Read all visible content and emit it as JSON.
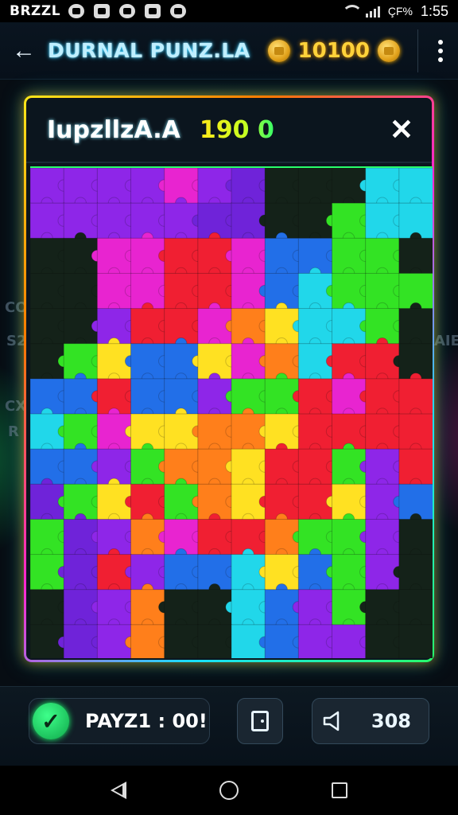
{
  "status_bar": {
    "carrier": "BRZZL",
    "battery": "ÇF%",
    "time": "1:55",
    "icons": [
      "whatsapp-icon",
      "image-icon",
      "alarm-icon",
      "screen-icon",
      "settings-icon"
    ]
  },
  "app_bar": {
    "title": "DURNAL PUNZ.LA",
    "coins": "10100"
  },
  "panel": {
    "title": "IupzllzA.A",
    "score": "190 0"
  },
  "background": {
    "left_text_1": "CO",
    "left_text_2": "S2",
    "left_text_3": "CX",
    "left_text_4": "R",
    "right_text_1": "AIE"
  },
  "toolbar": {
    "status_label": "PAYZ1 : 00!",
    "sound_value": "308"
  },
  "board": {
    "cols": 12,
    "rows": 14,
    "palette": {
      "purple": "#8a1ee8",
      "violet": "#6a1bd8",
      "magenta": "#e81ccf",
      "red": "#f0162a",
      "orange": "#ff7a12",
      "yellow": "#ffe01a",
      "green": "#2be21c",
      "lime": "#6bf51a",
      "cyan": "#18d6ea",
      "blue": "#1a6ae8",
      "dark": "#0b1a10",
      "darkpurple": "#2a0b4a"
    },
    "grid": [
      "PPPPMPVDDDCC",
      "PPPPPVVDDGCC",
      "DDMMRRMBBGGD",
      "DDMMRRMBCGGG",
      "DDPRRMOYCCGD",
      "DGYBBYMOCRRD",
      "BBRBBPGGRMRR",
      "CGMYYOOYRRRR",
      "BBPGOOYRRGPR",
      "VGYRGOYRRYPB",
      "GVPOMRROGGPD",
      "GVRPBBCYBGPD",
      "DVPODDCBPGDD",
      "DVPODDCBPPDD"
    ]
  }
}
